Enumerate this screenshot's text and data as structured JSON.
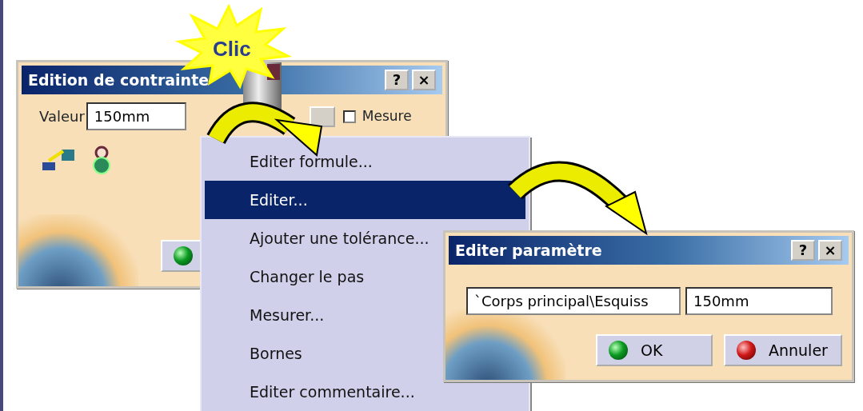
{
  "clic_label": "Clic",
  "dialog_constraint": {
    "title": "Edition de contrainte",
    "help_button": "?",
    "close_button": "×",
    "value_label": "Valeur",
    "value": "150mm",
    "measure_checkbox": {
      "label": "Mesure",
      "checked": false
    }
  },
  "context_menu": {
    "items": [
      {
        "label": "Editer formule...",
        "selected": false
      },
      {
        "label": "Editer...",
        "selected": true
      },
      {
        "label": "Ajouter une tolérance...",
        "selected": false
      },
      {
        "label": "Changer le pas",
        "selected": false
      },
      {
        "label": "Mesurer...",
        "selected": false
      },
      {
        "label": "Bornes",
        "selected": false
      },
      {
        "label": "Editer commentaire...",
        "selected": false
      }
    ]
  },
  "dialog_parameter": {
    "title": "Editer paramètre",
    "help_button": "?",
    "close_button": "×",
    "name_field": "`Corps principal\\Esquiss",
    "value": "150mm",
    "buttons": [
      {
        "label": "OK",
        "kind": "ok"
      },
      {
        "label": "Annuler",
        "kind": "cancel"
      }
    ]
  }
}
